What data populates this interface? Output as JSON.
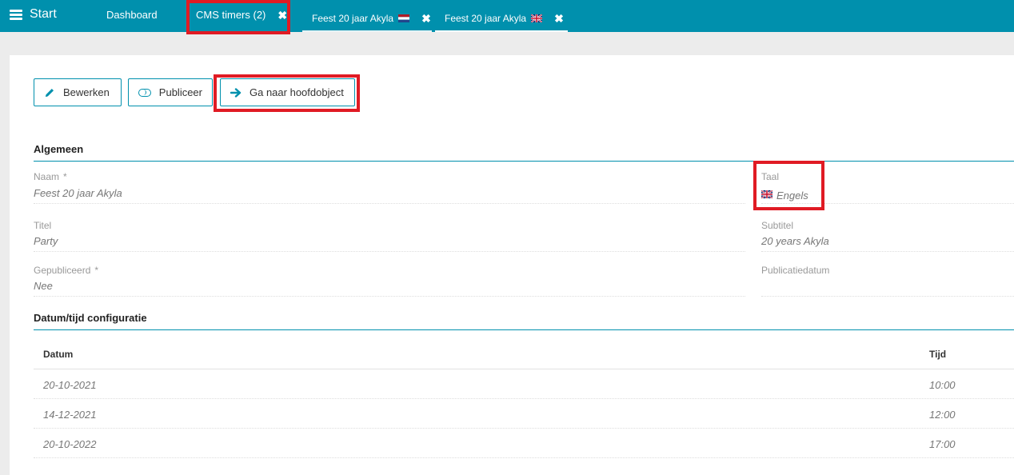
{
  "topbar": {
    "start_label": "Start",
    "tabs": [
      {
        "label": "Dashboard"
      },
      {
        "label": "CMS timers (2)"
      },
      {
        "label": "Feest 20 jaar Akyla"
      },
      {
        "label": "Feest 20 jaar Akyla"
      }
    ]
  },
  "toolbar": {
    "edit_label": "Bewerken",
    "publish_label": "Publiceer",
    "goto_label": "Ga naar hoofdobject"
  },
  "general": {
    "title": "Algemeen",
    "fields": {
      "naam": {
        "label": "Naam",
        "required": "*",
        "value": "Feest 20 jaar Akyla"
      },
      "taal": {
        "label": "Taal",
        "value": "Engels"
      },
      "titel": {
        "label": "Titel",
        "value": "Party"
      },
      "subtitel": {
        "label": "Subtitel",
        "value": "20 years Akyla"
      },
      "gepubliceerd": {
        "label": "Gepubliceerd",
        "required": "*",
        "value": "Nee"
      },
      "publicatiedatum": {
        "label": "Publicatiedatum",
        "value": ""
      }
    }
  },
  "datetime": {
    "title": "Datum/tijd configuratie",
    "columns": [
      "Datum",
      "Tijd"
    ],
    "rows": [
      {
        "datum": "20-10-2021",
        "tijd": "10:00"
      },
      {
        "datum": "14-12-2021",
        "tijd": "12:00"
      },
      {
        "datum": "20-10-2022",
        "tijd": "17:00"
      }
    ]
  },
  "colors": {
    "accent": "#0090ad",
    "highlight": "#e01b24"
  },
  "icons": [
    "hamburger-icon",
    "close-icon",
    "nl-flag-icon",
    "uk-flag-icon",
    "pencil-icon",
    "toggle-icon",
    "arrow-right-icon"
  ]
}
